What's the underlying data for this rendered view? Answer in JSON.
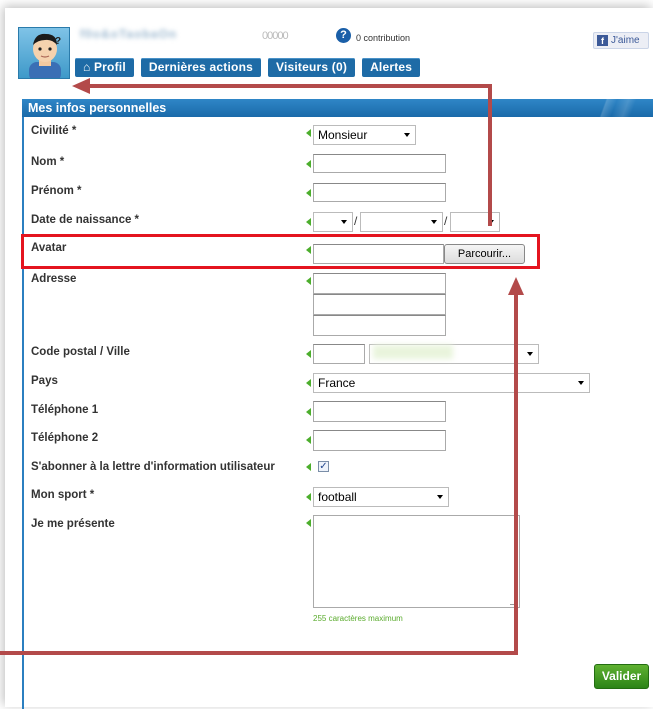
{
  "header": {
    "username": "f0o&oTaobaOn",
    "stars": "00000",
    "contribution_text": "0 contribution",
    "like_label": "J'aime",
    "like_icon": "f"
  },
  "tabs": [
    {
      "label": "⌂ Profil"
    },
    {
      "label": "Dernières actions"
    },
    {
      "label": "Visiteurs (0)"
    },
    {
      "label": "Alertes"
    }
  ],
  "panel": {
    "title": "Mes infos personnelles"
  },
  "form": {
    "civilite": {
      "label": "Civilité *",
      "value": "Monsieur"
    },
    "nom": {
      "label": "Nom *",
      "value": ""
    },
    "prenom": {
      "label": "Prénom *",
      "value": ""
    },
    "date_naissance": {
      "label": "Date de naissance *",
      "day": "",
      "month": "",
      "year": ""
    },
    "avatar": {
      "label": "Avatar",
      "button": "Parcourir..."
    },
    "adresse": {
      "label": "Adresse"
    },
    "code_postal": {
      "label": "Code postal / Ville",
      "value": ""
    },
    "pays": {
      "label": "Pays",
      "value": "France"
    },
    "tel1": {
      "label": "Téléphone 1",
      "value": ""
    },
    "tel2": {
      "label": "Téléphone 2",
      "value": ""
    },
    "newsletter": {
      "label": "S'abonner à la lettre d'information utilisateur",
      "checked": "☑",
      "check_mark": "✓"
    },
    "sport": {
      "label": "Mon sport *",
      "value": "football"
    },
    "presentation": {
      "label": "Je me présente",
      "hint": "255 caractères maximum"
    },
    "submit": "Valider"
  },
  "colors": {
    "tab_blue": "#1e6ba6",
    "marker_green": "#4cae2c",
    "annotation_red": "#e4141f",
    "arrow_red": "#b34a4a"
  }
}
